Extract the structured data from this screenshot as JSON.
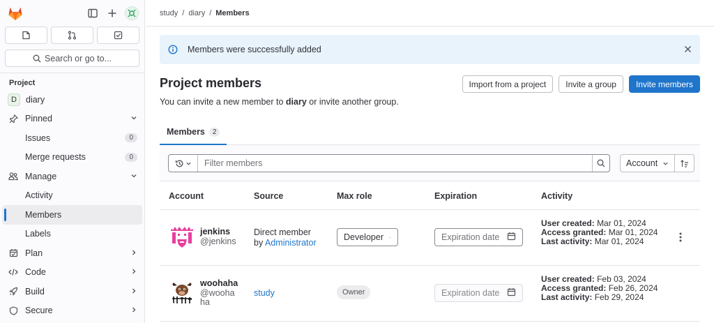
{
  "breadcrumb": {
    "items": [
      "study",
      "diary"
    ],
    "current": "Members",
    "separator": "/"
  },
  "sidebar": {
    "search_label": "Search or go to...",
    "section_title": "Project",
    "project": {
      "initial": "D",
      "name": "diary"
    },
    "items": [
      {
        "label": "Pinned"
      },
      {
        "label": "Issues",
        "badge": "0"
      },
      {
        "label": "Merge requests",
        "badge": "0"
      },
      {
        "label": "Manage"
      },
      {
        "label": "Activity"
      },
      {
        "label": "Members"
      },
      {
        "label": "Labels"
      },
      {
        "label": "Plan"
      },
      {
        "label": "Code"
      },
      {
        "label": "Build"
      },
      {
        "label": "Secure"
      }
    ]
  },
  "alert": {
    "message": "Members were successfully added"
  },
  "header": {
    "title": "Project members",
    "subtitle_pre": "You can invite a new member to ",
    "subtitle_project": "diary",
    "subtitle_post": " or invite another group.",
    "buttons": {
      "import": "Import from a project",
      "invite_group": "Invite a group",
      "invite_members": "Invite members"
    }
  },
  "tabs": [
    {
      "label": "Members",
      "count": "2"
    }
  ],
  "filter": {
    "placeholder": "Filter members",
    "sort_label": "Account"
  },
  "table": {
    "columns": [
      "Account",
      "Source",
      "Max role",
      "Expiration",
      "Activity"
    ],
    "rows": [
      {
        "name": "jenkins",
        "handle": "@jenkins",
        "source_line1": "Direct member",
        "source_by": "by ",
        "source_link": "Administrator",
        "role": "Developer",
        "expiration_placeholder": "Expiration date",
        "activity": {
          "created_label": "User created:",
          "created": "Mar 01, 2024",
          "granted_label": "Access granted:",
          "granted": "Mar 01, 2024",
          "last_label": "Last activity:",
          "last": "Mar 01, 2024"
        }
      },
      {
        "name": "woohaha",
        "handle_line1": "@wooha",
        "handle_line2": "ha",
        "source_link": "study",
        "role": "Owner",
        "expiration_placeholder": "Expiration date",
        "activity": {
          "created_label": "User created:",
          "created": "Feb 03, 2024",
          "granted_label": "Access granted:",
          "granted": "Feb 26, 2024",
          "last_label": "Last activity:",
          "last": "Feb 29, 2024"
        }
      }
    ]
  },
  "colors": {
    "primary": "#1f75cb",
    "alert_bg": "#e9f3fc",
    "logo": "#e24329"
  }
}
